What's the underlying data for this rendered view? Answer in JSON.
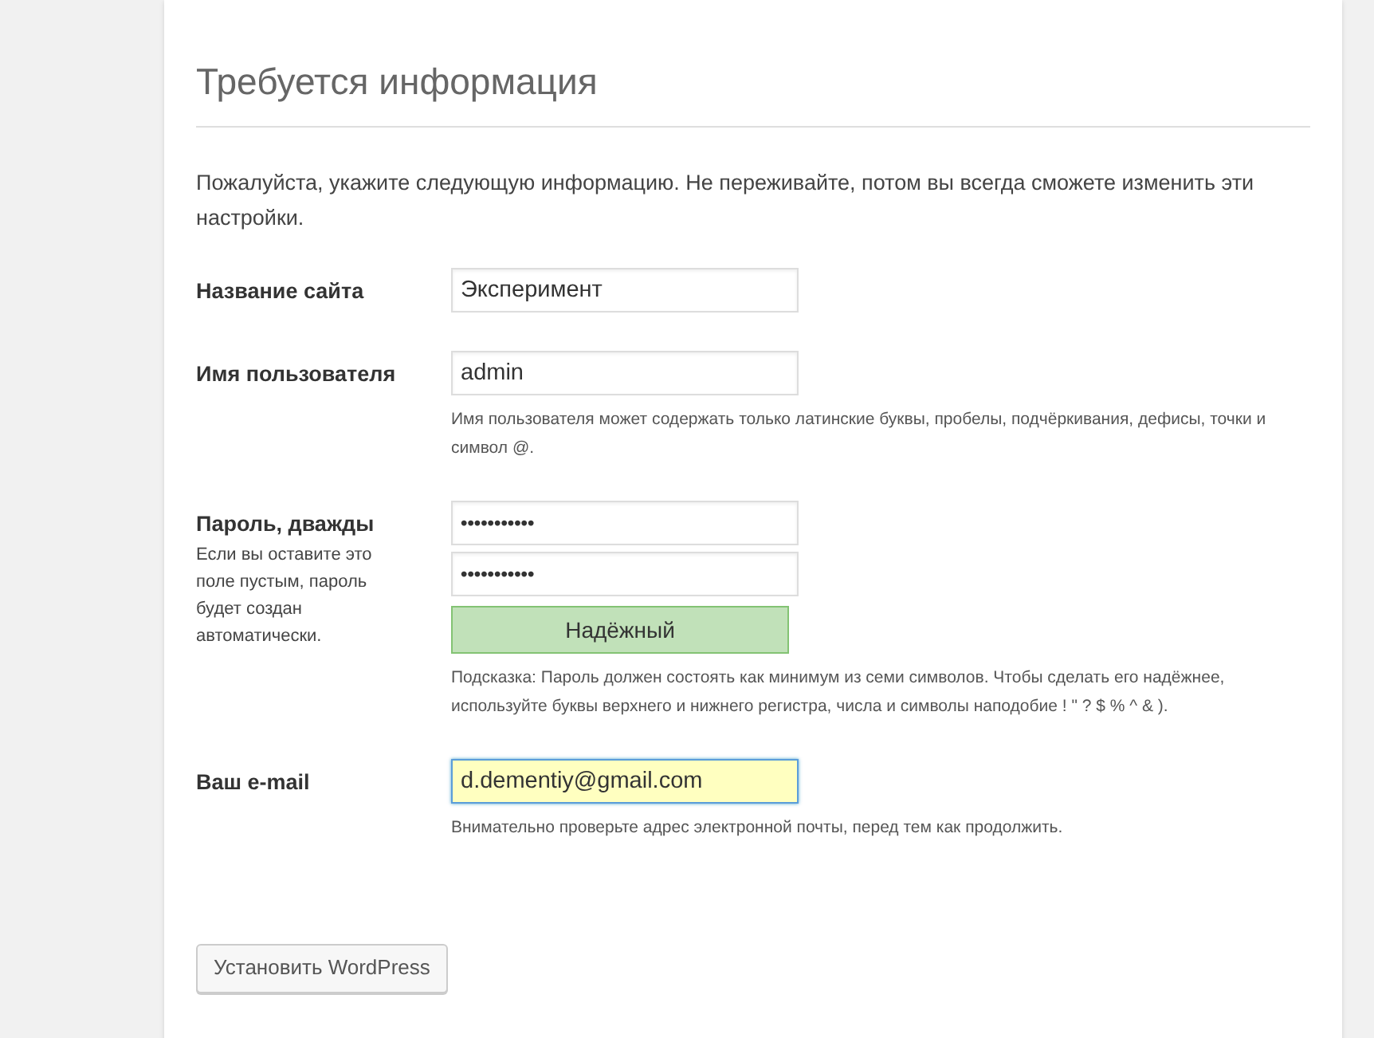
{
  "heading": "Требуется информация",
  "intro": "Пожалуйста, укажите следующую информацию. Не переживайте, потом вы всегда сможете изменить эти настройки.",
  "fields": [
    {
      "kind": "text",
      "label": "Название сайта",
      "values": [
        "Эксперимент"
      ],
      "focused": false
    },
    {
      "kind": "text",
      "label": "Имя пользователя",
      "values": [
        "admin"
      ],
      "focused": false,
      "hint": "Имя пользователя может содержать только латинские буквы, пробелы, подчёркивания, дефисы, точки и символ @."
    },
    {
      "kind": "password",
      "label": "Пароль, дважды",
      "sublabel": "Если вы оставите это поле пустым, пароль будет создан автоматически.",
      "values": [
        "•••••••••••",
        "•••••••••••"
      ],
      "focused": false,
      "strength": {
        "label": "Надёжный",
        "kind": "strong"
      },
      "hint": "Подсказка: Пароль должен состоять как минимум из семи символов. Чтобы сделать его надёжнее, используйте буквы верхнего и нижнего регистра, числа и символы наподобие ! \" ? $ % ^ & )."
    },
    {
      "kind": "email",
      "label": "Ваш e-mail",
      "values": [
        "d.dementiy@gmail.com"
      ],
      "focused": true,
      "hint": "Внимательно проверьте адрес электронной почты, перед тем как продолжить."
    }
  ],
  "submit": "Установить WordPress"
}
